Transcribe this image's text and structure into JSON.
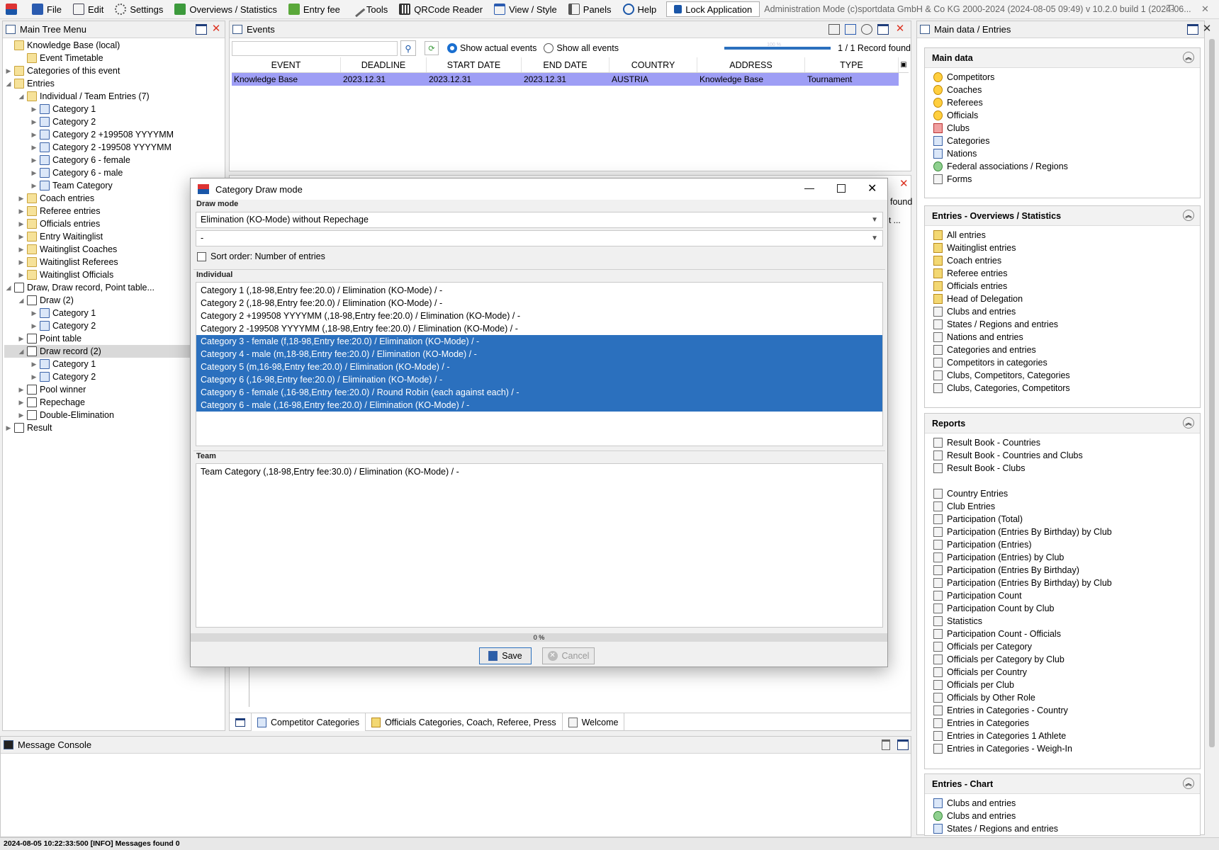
{
  "menu": {
    "items": [
      "File",
      "Edit",
      "Settings",
      "Overviews / Statistics",
      "Entry fee",
      "Tools",
      "QRCode Reader",
      "View / Style",
      "Panels",
      "Help"
    ],
    "lock": "Lock Application",
    "info": "Administration Mode (c)sportdata GmbH & Co KG 2000-2024 (2024-08-05 09:49)  v 10.2.0 build 1 (2024-06..."
  },
  "tree_panel": {
    "title": "Main Tree Menu",
    "rows": [
      {
        "label": "Knowledge Base (local)",
        "level": 0,
        "tw": ""
      },
      {
        "label": "Event Timetable",
        "level": 1,
        "tw": ""
      },
      {
        "label": "Categories of this event",
        "level": 0,
        "tw": "▶"
      },
      {
        "label": "Entries",
        "level": 0,
        "tw": "◢"
      },
      {
        "label": "Individual / Team Entries (7)",
        "level": 1,
        "tw": "◢"
      },
      {
        "label": "Category 1",
        "level": 2,
        "tw": "▶"
      },
      {
        "label": "Category 2",
        "level": 2,
        "tw": "▶"
      },
      {
        "label": "Category 2 +199508 YYYYMM",
        "level": 2,
        "tw": "▶"
      },
      {
        "label": "Category 2 -199508 YYYYMM",
        "level": 2,
        "tw": "▶"
      },
      {
        "label": "Category 6 - female",
        "level": 2,
        "tw": "▶"
      },
      {
        "label": "Category 6 - male",
        "level": 2,
        "tw": "▶"
      },
      {
        "label": "Team Category",
        "level": 2,
        "tw": "▶"
      },
      {
        "label": "Coach entries",
        "level": 1,
        "tw": "▶"
      },
      {
        "label": "Referee entries",
        "level": 1,
        "tw": "▶"
      },
      {
        "label": "Officials entries",
        "level": 1,
        "tw": "▶"
      },
      {
        "label": "Entry Waitinglist",
        "level": 1,
        "tw": "▶"
      },
      {
        "label": "Waitinglist Coaches",
        "level": 1,
        "tw": "▶"
      },
      {
        "label": "Waitinglist Referees",
        "level": 1,
        "tw": "▶"
      },
      {
        "label": "Waitinglist Officials",
        "level": 1,
        "tw": "▶"
      },
      {
        "label": "Draw, Draw record, Point table...",
        "level": 0,
        "tw": "◢"
      },
      {
        "label": "Draw (2)",
        "level": 1,
        "tw": "◢"
      },
      {
        "label": "Category 1",
        "level": 2,
        "tw": "▶"
      },
      {
        "label": "Category 2",
        "level": 2,
        "tw": "▶"
      },
      {
        "label": "Point table",
        "level": 1,
        "tw": "▶"
      },
      {
        "label": "Draw record (2)",
        "level": 1,
        "tw": "◢",
        "selected": true
      },
      {
        "label": "Category 1",
        "level": 2,
        "tw": "▶"
      },
      {
        "label": "Category 2",
        "level": 2,
        "tw": "▶"
      },
      {
        "label": "Pool winner",
        "level": 1,
        "tw": "▶"
      },
      {
        "label": "Repechage",
        "level": 1,
        "tw": "▶"
      },
      {
        "label": "Double-Elimination",
        "level": 1,
        "tw": "▶"
      },
      {
        "label": "Result",
        "level": 0,
        "tw": "▶"
      }
    ]
  },
  "events": {
    "title": "Events",
    "search_value": "",
    "radio_actual": "Show actual events",
    "radio_all": "Show all events",
    "progress_label": "100 %",
    "record_count": "1 / 1 Record found",
    "columns": [
      "EVENT",
      "DEADLINE",
      "START DATE",
      "END DATE",
      "COUNTRY",
      "ADDRESS",
      "TYPE"
    ],
    "rows": [
      [
        "Knowledge Base",
        "2023.12.31",
        "2023.12.31",
        "2023.12.31",
        "AUSTRIA",
        "Knowledge Base",
        "Tournament"
      ]
    ]
  },
  "behind_panel": {
    "found_text": "found",
    "col_text": "t ..."
  },
  "tabs": [
    "Competitor Categories",
    "Officials Categories, Coach, Referee, Press",
    "Welcome"
  ],
  "console": {
    "title": "Message Console"
  },
  "status": "2024-08-05 10:22:33:500 [INFO] Messages found 0",
  "dialog": {
    "title": "Category Draw mode",
    "draw_mode_label": "Draw mode",
    "combo1": "Elimination (KO-Mode) without Repechage",
    "combo2": "-",
    "sort_label": "Sort order: Number of entries",
    "individual_label": "Individual",
    "individual_items": [
      {
        "text": "Category 1 (,18-98,Entry fee:20.0) / Elimination (KO-Mode) / -",
        "selected": false
      },
      {
        "text": "Category 2 (,18-98,Entry fee:20.0) / Elimination (KO-Mode) / -",
        "selected": false
      },
      {
        "text": "Category 2 +199508 YYYYMM (,18-98,Entry fee:20.0) / Elimination (KO-Mode) / -",
        "selected": false
      },
      {
        "text": "Category 2 -199508 YYYYMM (,18-98,Entry fee:20.0) / Elimination (KO-Mode) / -",
        "selected": false
      },
      {
        "text": "Category 3 - female (f,18-98,Entry fee:20.0) / Elimination (KO-Mode) / -",
        "selected": true
      },
      {
        "text": "Category 4 - male (m,18-98,Entry fee:20.0) / Elimination (KO-Mode) / -",
        "selected": true
      },
      {
        "text": "Category 5 (m,16-98,Entry fee:20.0) / Elimination (KO-Mode) / -",
        "selected": true
      },
      {
        "text": "Category 6 (,16-98,Entry fee:20.0) / Elimination (KO-Mode) / -",
        "selected": true
      },
      {
        "text": "Category 6 - female (,16-98,Entry fee:20.0) / Round Robin (each against each) / -",
        "selected": true
      },
      {
        "text": "Category 6 - male (,16-98,Entry fee:20.0) / Elimination (KO-Mode) / -",
        "selected": true
      }
    ],
    "team_label": "Team",
    "team_items": [
      "Team Category (,18-98,Entry fee:30.0) / Elimination (KO-Mode) / -"
    ],
    "progress": "0 %",
    "save": "Save",
    "cancel": "Cancel"
  },
  "right": {
    "title": "Main data / Entries",
    "sections": [
      {
        "title": "Main data",
        "items": [
          {
            "label": "Competitors",
            "icon": "c"
          },
          {
            "label": "Coaches",
            "icon": "c"
          },
          {
            "label": "Referees",
            "icon": "c"
          },
          {
            "label": "Officials",
            "icon": "c"
          },
          {
            "label": "Clubs",
            "icon": "r"
          },
          {
            "label": "Categories",
            "icon": "b"
          },
          {
            "label": "Nations",
            "icon": "b"
          },
          {
            "label": "Federal associations / Regions",
            "icon": "g"
          },
          {
            "label": "Forms",
            "icon": ""
          }
        ]
      },
      {
        "title": "Entries - Overviews / Statistics",
        "items": [
          {
            "label": "All entries",
            "icon": "y"
          },
          {
            "label": "Waitinglist entries",
            "icon": "y"
          },
          {
            "label": "Coach entries",
            "icon": "y"
          },
          {
            "label": "Referee entries",
            "icon": "y"
          },
          {
            "label": "Officials entries",
            "icon": "y"
          },
          {
            "label": "Head of Delegation",
            "icon": "y"
          },
          {
            "label": "Clubs and entries",
            "icon": ""
          },
          {
            "label": "States / Regions and entries",
            "icon": ""
          },
          {
            "label": "Nations and entries",
            "icon": ""
          },
          {
            "label": "Categories and entries",
            "icon": ""
          },
          {
            "label": "Competitors in categories",
            "icon": ""
          },
          {
            "label": "Clubs, Competitors, Categories",
            "icon": ""
          },
          {
            "label": "Clubs, Categories, Competitors",
            "icon": ""
          }
        ]
      },
      {
        "title": "Reports",
        "items": [
          {
            "label": "Result Book - Countries",
            "icon": ""
          },
          {
            "label": "Result Book - Countries and Clubs",
            "icon": ""
          },
          {
            "label": "Result Book - Clubs",
            "icon": ""
          },
          {
            "label": "",
            "icon": "gap"
          },
          {
            "label": "Country Entries",
            "icon": ""
          },
          {
            "label": "Club Entries",
            "icon": ""
          },
          {
            "label": "Participation (Total)",
            "icon": ""
          },
          {
            "label": "Participation (Entries By Birthday) by Club",
            "icon": ""
          },
          {
            "label": "Participation (Entries)",
            "icon": ""
          },
          {
            "label": "Participation (Entries) by Club",
            "icon": ""
          },
          {
            "label": "Participation (Entries By Birthday)",
            "icon": ""
          },
          {
            "label": "Participation (Entries By Birthday) by Club",
            "icon": ""
          },
          {
            "label": "Participation Count",
            "icon": ""
          },
          {
            "label": "Participation Count by Club",
            "icon": ""
          },
          {
            "label": "Statistics",
            "icon": ""
          },
          {
            "label": "Participation Count - Officials",
            "icon": ""
          },
          {
            "label": "Officials per Category",
            "icon": ""
          },
          {
            "label": "Officials per Category by Club",
            "icon": ""
          },
          {
            "label": "Officials per Country",
            "icon": ""
          },
          {
            "label": "Officials per Club",
            "icon": ""
          },
          {
            "label": "Officials by Other Role",
            "icon": ""
          },
          {
            "label": "Entries in Categories - Country",
            "icon": ""
          },
          {
            "label": "Entries in Categories",
            "icon": ""
          },
          {
            "label": "Entries in Categories 1 Athlete",
            "icon": ""
          },
          {
            "label": "Entries in Categories - Weigh-In",
            "icon": ""
          }
        ]
      },
      {
        "title": "Entries - Chart",
        "items": [
          {
            "label": "Clubs and entries",
            "icon": "b"
          },
          {
            "label": "Clubs and entries",
            "icon": "g"
          },
          {
            "label": "States / Regions and entries",
            "icon": "b"
          }
        ]
      }
    ]
  }
}
